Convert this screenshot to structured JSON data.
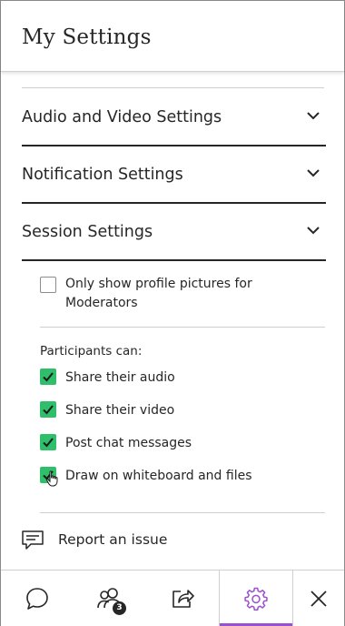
{
  "header": {
    "title": "My Settings"
  },
  "sections": [
    {
      "label": "Audio and Video Settings"
    },
    {
      "label": "Notification Settings"
    },
    {
      "label": "Session Settings"
    }
  ],
  "session": {
    "profile_option": {
      "label": "Only show profile pictures for Moderators",
      "checked": false
    },
    "participants_heading": "Participants can:",
    "permissions": [
      {
        "label": "Share their audio",
        "checked": true
      },
      {
        "label": "Share their video",
        "checked": true
      },
      {
        "label": "Post chat messages",
        "checked": true
      },
      {
        "label": "Draw on whiteboard and files",
        "checked": true
      }
    ]
  },
  "report": {
    "label": "Report an issue",
    "icon": "report-icon"
  },
  "tabbar": {
    "tabs": [
      {
        "name": "chat",
        "icon": "chat-icon"
      },
      {
        "name": "attendees",
        "icon": "attendees-icon",
        "badge": "3"
      },
      {
        "name": "share-content",
        "icon": "share-icon"
      },
      {
        "name": "my-settings",
        "icon": "gear-icon",
        "active": true
      },
      {
        "name": "close",
        "icon": "close-icon"
      }
    ]
  },
  "colors": {
    "accent": "#9b4fd1",
    "checkbox": "#2fbf6b",
    "text": "#262626"
  }
}
